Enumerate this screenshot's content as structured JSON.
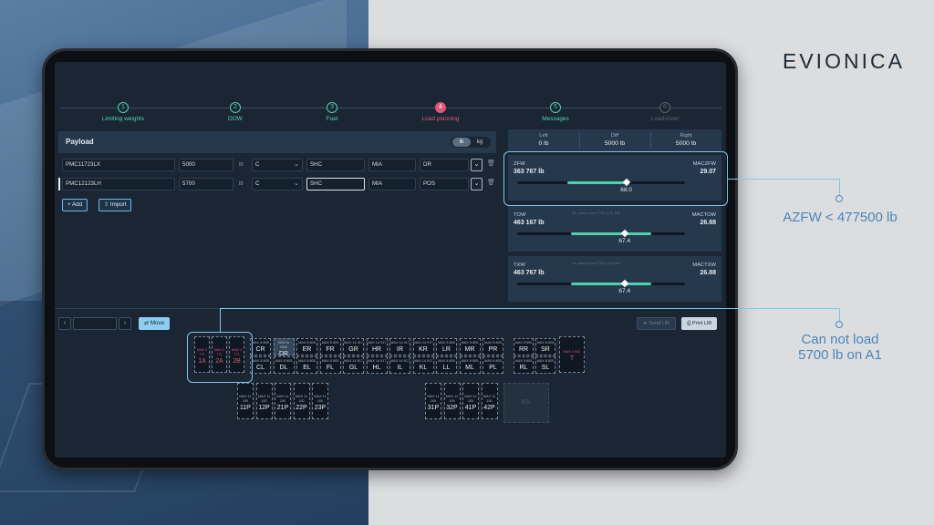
{
  "brand": "EVIONICA",
  "steps": [
    {
      "num": "1",
      "label": "Limiting weights"
    },
    {
      "num": "2",
      "label": "DOW"
    },
    {
      "num": "3",
      "label": "Fuel"
    },
    {
      "num": "4",
      "label": "Load planning"
    },
    {
      "num": "5",
      "label": "Messages"
    },
    {
      "num": "6",
      "label": "Loadsheet"
    }
  ],
  "payload": {
    "title": "Payload",
    "unit_lb": "lb",
    "unit_kg": "kg",
    "rows": [
      {
        "id": "PMC11723LX",
        "weight": "5000",
        "unit": "lb",
        "category": "C",
        "shc": "SHC",
        "dest": "MIA",
        "pos": "DR"
      },
      {
        "id": "PMC12123LH",
        "weight": "5700",
        "unit": "lb",
        "category": "C",
        "shc": "SHC",
        "dest": "MIA",
        "pos": "POS"
      }
    ],
    "add_label": "Add",
    "import_label": "Import"
  },
  "balance": {
    "left_label": "Left",
    "left_value": "0 lb",
    "diff_label": "Diff",
    "diff_value": "5000 lb",
    "right_label": "Right",
    "right_value": "5000 lb"
  },
  "cards": [
    {
      "key": "ZFW",
      "value": "363 767 lb",
      "mac_key": "MACZFW",
      "mac_value": "29.07",
      "pct": "68.0",
      "note": "",
      "fill_from": 0.3,
      "fill_to": 0.66,
      "knob": 0.65
    },
    {
      "key": "TOW",
      "value": "463 167 lb",
      "mac_key": "MACTOW",
      "mac_value": "26.88",
      "pct": "67.4",
      "note": "Tie-down input TOW (LG) Mid",
      "fill_from": 0.32,
      "fill_to": 0.8,
      "knob": 0.64
    },
    {
      "key": "TXW",
      "value": "463 767 lb",
      "mac_key": "MACTXW",
      "mac_value": "26.88",
      "pct": "67.4",
      "note": "Tie-down input TXW (LG) Mid",
      "fill_from": 0.32,
      "fill_to": 0.8,
      "knob": 0.64
    }
  ],
  "lower": {
    "move_label": "Move",
    "send_label": "Send LIR",
    "print_label": "Print LIR",
    "main_deck_red": [
      {
        "mx": "MAX 4 771",
        "id": "1A"
      },
      {
        "mx": "MAX 4 771",
        "id": "2A"
      },
      {
        "mx": "MAX 4 771",
        "id": "2B"
      }
    ],
    "main_deck_top": [
      {
        "mx": "MAX 8 805",
        "id": "CR"
      },
      {
        "mx": "5000 lb HNB",
        "id": "DR"
      },
      {
        "mx": "MAX 8 805",
        "id": "ER"
      },
      {
        "mx": "MAX 8 805",
        "id": "FR"
      },
      {
        "mx": "MAX 14 917",
        "id": "GR"
      },
      {
        "mx": "MAX 14 917",
        "id": "HR"
      },
      {
        "mx": "MAX 14 917",
        "id": "IR"
      },
      {
        "mx": "MAX 14 917",
        "id": "KR"
      },
      {
        "mx": "MAX 8 805",
        "id": "LR"
      },
      {
        "mx": "MAX 8 805",
        "id": "MR"
      },
      {
        "mx": "MAX 8 805",
        "id": "PR"
      }
    ],
    "main_deck_bottom": [
      {
        "mx": "MAX 8 805",
        "id": "CL"
      },
      {
        "mx": "MAX 8 805",
        "id": "DL"
      },
      {
        "mx": "MAX 8 805",
        "id": "EL"
      },
      {
        "mx": "MAX 8 805",
        "id": "FL"
      },
      {
        "mx": "MAX 14 917",
        "id": "GL"
      },
      {
        "mx": "MAX 14 917",
        "id": "HL"
      },
      {
        "mx": "MAX 14 917",
        "id": "IL"
      },
      {
        "mx": "MAX 14 917",
        "id": "KL"
      },
      {
        "mx": "MAX 8 805",
        "id": "LL"
      },
      {
        "mx": "MAX 8 805",
        "id": "ML"
      },
      {
        "mx": "MAX 8 805",
        "id": "PL"
      }
    ],
    "aft_top": [
      {
        "mx": "MAX 8 805",
        "id": "RR"
      },
      {
        "mx": "MAX 8 805",
        "id": "SR"
      }
    ],
    "aft_bottom": [
      {
        "mx": "MAX 8 805",
        "id": "RL"
      },
      {
        "mx": "MAX 8 805",
        "id": "SL"
      }
    ],
    "tail": {
      "mx": "MAX 4 902",
      "id": "T"
    },
    "lower_fwd": [
      {
        "mx": "MAX 11 100",
        "id": "11P"
      },
      {
        "mx": "MAX 11 100",
        "id": "12P"
      },
      {
        "mx": "MAX 11 100",
        "id": "21P"
      },
      {
        "mx": "MAX 11 100",
        "id": "22P"
      },
      {
        "mx": "MAX 11 100",
        "id": "23P"
      }
    ],
    "lower_aft": [
      {
        "mx": "MAX 11 100",
        "id": "31P"
      },
      {
        "mx": "MAX 11 100",
        "id": "32P"
      },
      {
        "mx": "MAX 11 100",
        "id": "41P"
      },
      {
        "mx": "MAX 11 100",
        "id": "42P"
      }
    ],
    "bulk": {
      "id": "45L"
    }
  },
  "callouts": {
    "azfw": "AZFW < 477500 lb",
    "cannot_line1": "Can not load",
    "cannot_line2": "5700 lb on A1"
  },
  "colors": {
    "accent": "#4fd1b0",
    "active": "#e0557a",
    "callout": "#7fc6ee"
  }
}
